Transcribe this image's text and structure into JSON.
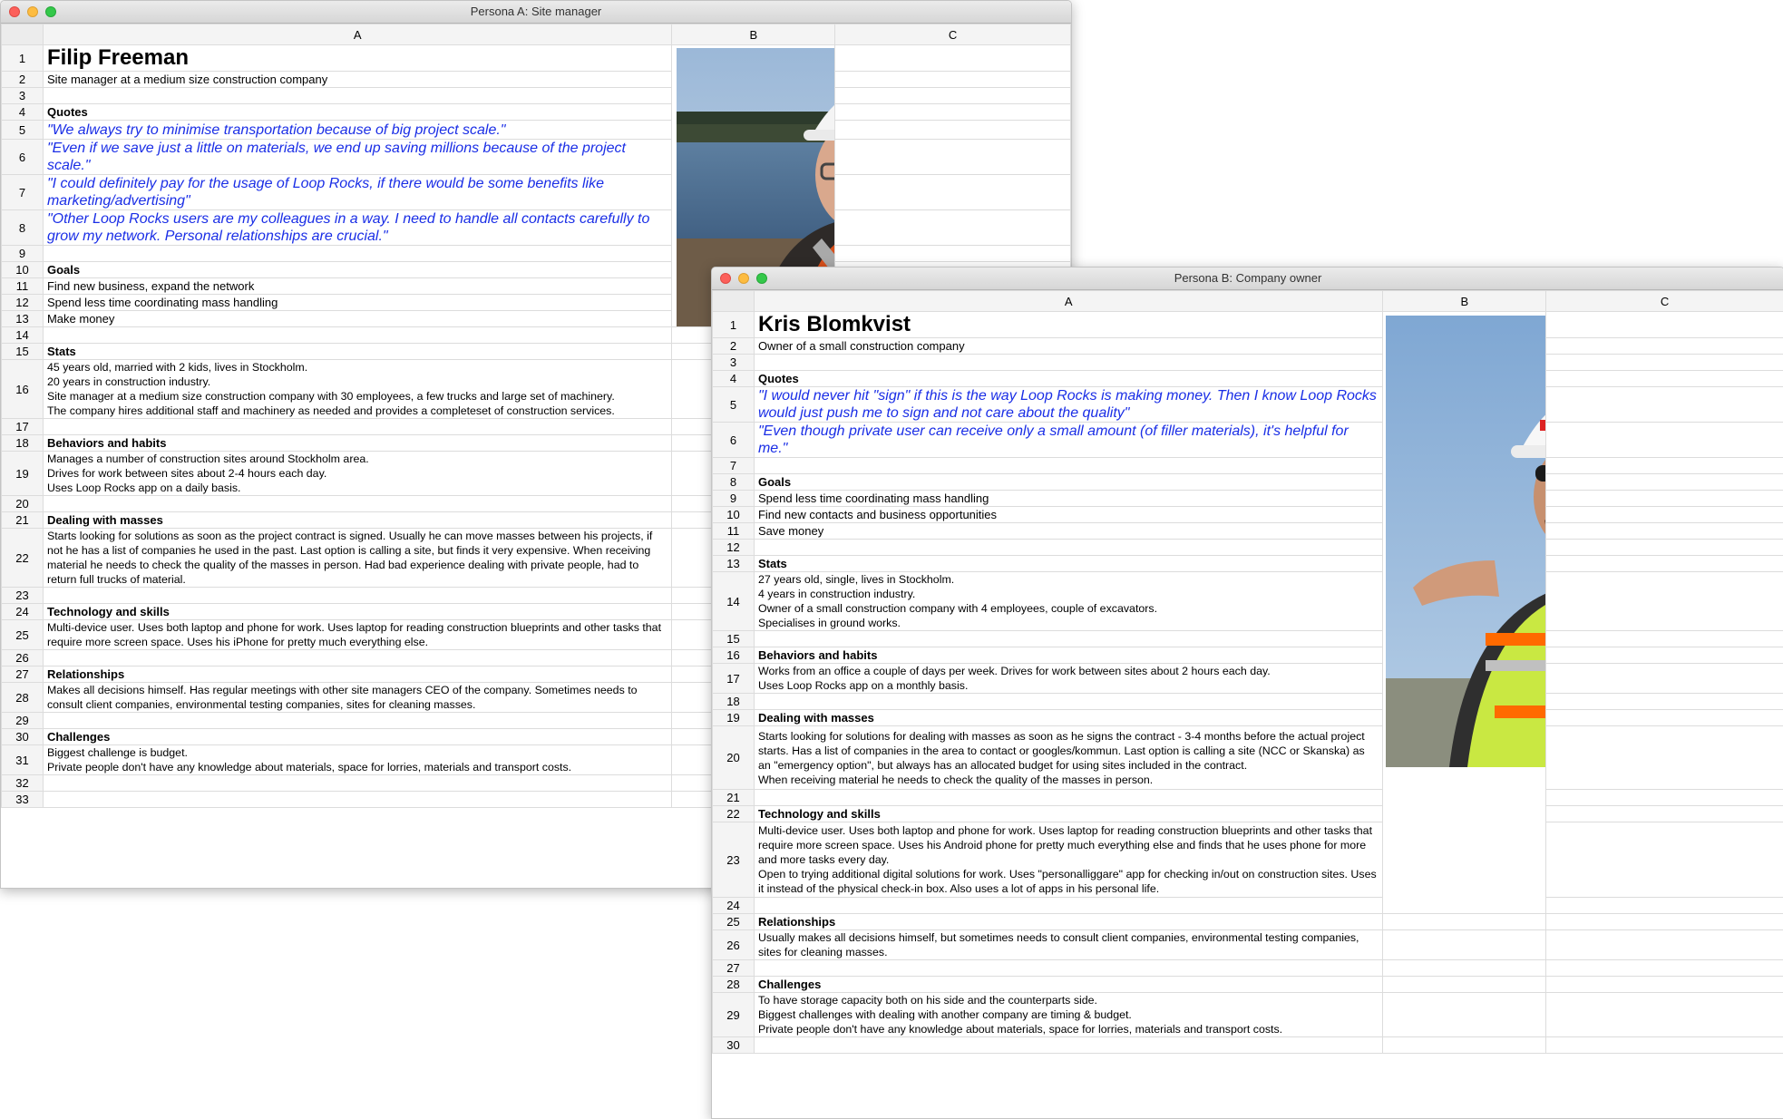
{
  "personaA": {
    "window_title": "Persona A: Site manager",
    "columns": [
      "A",
      "B",
      "C"
    ],
    "rows": [
      {
        "n": "1",
        "text": "Filip Freeman",
        "style": "name"
      },
      {
        "n": "2",
        "text": "Site manager at a medium size construction company",
        "style": "text"
      },
      {
        "n": "3",
        "text": "",
        "style": "text"
      },
      {
        "n": "4",
        "text": "Quotes",
        "style": "heading"
      },
      {
        "n": "5",
        "text": "\"We always try to minimise transportation because of big project scale.\"",
        "style": "quote"
      },
      {
        "n": "6",
        "text": "\"Even if we save just a little on materials, we end up saving millions because of the project scale.\"",
        "style": "quote"
      },
      {
        "n": "7",
        "text": "\"I could definitely pay for the usage of Loop Rocks, if there would be some benefits like marketing/advertising\"",
        "style": "quote"
      },
      {
        "n": "8",
        "text": "\"Other Loop Rocks users are my colleagues in a way. I need to handle all contacts carefully to grow my network. Personal relationships are crucial.\"",
        "style": "quote"
      },
      {
        "n": "9",
        "text": "",
        "style": "text"
      },
      {
        "n": "10",
        "text": "Goals",
        "style": "heading"
      },
      {
        "n": "11",
        "text": "Find new business, expand the network",
        "style": "text"
      },
      {
        "n": "12",
        "text": "Spend less time coordinating mass handling",
        "style": "text"
      },
      {
        "n": "13",
        "text": "Make money",
        "style": "text"
      },
      {
        "n": "14",
        "text": "",
        "style": "text"
      },
      {
        "n": "15",
        "text": "Stats",
        "style": "heading"
      },
      {
        "n": "16",
        "text": "45 years old, married with 2 kids, lives in Stockholm.\n20 years in construction industry.\nSite manager at a medium size construction company with 30 employees, a few trucks and large set of machinery.\nThe company hires additional staff and machinery as needed and provides a completeset of construction services.",
        "style": "small"
      },
      {
        "n": "17",
        "text": "",
        "style": "text"
      },
      {
        "n": "18",
        "text": "Behaviors and habits",
        "style": "heading"
      },
      {
        "n": "19",
        "text": "Manages a number of construction sites around Stockholm area.\nDrives for work between sites about 2-4 hours each day.\nUses Loop Rocks app on a daily basis.",
        "style": "small"
      },
      {
        "n": "20",
        "text": "",
        "style": "text"
      },
      {
        "n": "21",
        "text": "Dealing with masses",
        "style": "heading"
      },
      {
        "n": "22",
        "text": "Starts looking for solutions as soon as the project contract is signed. Usually he can move masses between his projects, if not he has a list of companies he used in the past. Last option is calling a site, but finds it very expensive. When receiving material he needs to check the quality of the masses in person. Had bad experience dealing with private people, had to return full trucks of material.",
        "style": "small"
      },
      {
        "n": "23",
        "text": "",
        "style": "text"
      },
      {
        "n": "24",
        "text": "Technology and skills",
        "style": "heading"
      },
      {
        "n": "25",
        "text": "Multi-device user. Uses both laptop and phone for work. Uses laptop for reading construction blueprints and other tasks that require more screen space. Uses his iPhone for pretty much everything else.",
        "style": "small"
      },
      {
        "n": "26",
        "text": "",
        "style": "text"
      },
      {
        "n": "27",
        "text": "Relationships",
        "style": "heading"
      },
      {
        "n": "28",
        "text": "Makes all decisions himself. Has regular meetings with other site managers CEO of the company. Sometimes needs to consult client companies, environmental testing companies, sites for cleaning masses.",
        "style": "small"
      },
      {
        "n": "29",
        "text": "",
        "style": "text"
      },
      {
        "n": "30",
        "text": "Challenges",
        "style": "heading"
      },
      {
        "n": "31",
        "text": "Biggest challenge is budget.\nPrivate people don't have any knowledge about materials, space for lorries, materials and transport costs.",
        "style": "small"
      },
      {
        "n": "32",
        "text": "",
        "style": "text"
      },
      {
        "n": "33",
        "text": "",
        "style": "text"
      }
    ]
  },
  "personaB": {
    "window_title": "Persona B: Company owner",
    "columns": [
      "A",
      "B",
      "C"
    ],
    "rows": [
      {
        "n": "1",
        "text": "Kris Blomkvist",
        "style": "name"
      },
      {
        "n": "2",
        "text": "Owner of a small construction company",
        "style": "text"
      },
      {
        "n": "3",
        "text": "",
        "style": "text"
      },
      {
        "n": "4",
        "text": "Quotes",
        "style": "heading"
      },
      {
        "n": "5",
        "text": "\"I would never hit \"sign\" if this is the way Loop Rocks is making money. Then I know Loop Rocks would just push me to sign and not care about the quality\"",
        "style": "quote"
      },
      {
        "n": "6",
        "text": "\"Even though private user can receive only a small amount (of filler materials), it's helpful for me.\"",
        "style": "quote"
      },
      {
        "n": "7",
        "text": "",
        "style": "text"
      },
      {
        "n": "8",
        "text": "Goals",
        "style": "heading"
      },
      {
        "n": "9",
        "text": "Spend less time coordinating mass handling",
        "style": "text"
      },
      {
        "n": "10",
        "text": "Find new contacts and business opportunities",
        "style": "text"
      },
      {
        "n": "11",
        "text": "Save money",
        "style": "text"
      },
      {
        "n": "12",
        "text": "",
        "style": "text"
      },
      {
        "n": "13",
        "text": "Stats",
        "style": "heading"
      },
      {
        "n": "14",
        "text": "27 years old, single, lives in Stockholm.\n4 years in construction industry.\nOwner of a small construction company with 4 employees, couple of excavators.\nSpecialises in ground works.",
        "style": "small"
      },
      {
        "n": "15",
        "text": "",
        "style": "text"
      },
      {
        "n": "16",
        "text": "Behaviors and habits",
        "style": "heading"
      },
      {
        "n": "17",
        "text": "Works from an office a couple of days per week. Drives for work between sites about 2 hours each day.\nUses Loop Rocks app on a monthly basis.",
        "style": "small"
      },
      {
        "n": "18",
        "text": "",
        "style": "text"
      },
      {
        "n": "19",
        "text": "Dealing with masses",
        "style": "heading"
      },
      {
        "n": "20",
        "text": "Starts looking for solutions for dealing with masses as soon as he signs the contract - 3-4 months before the actual project starts. Has a list of companies in the area to contact or googles/kommun. Last option is calling a site (NCC or Skanska) as an \"emergency option\", but always has an allocated budget for using sites included in the contract.\nWhen receiving material he needs to check the quality of the masses in person.",
        "style": "small"
      },
      {
        "n": "21",
        "text": "",
        "style": "text"
      },
      {
        "n": "22",
        "text": "Technology and skills",
        "style": "heading"
      },
      {
        "n": "23",
        "text": "Multi-device user. Uses both laptop and phone for work. Uses laptop for reading construction blueprints and other tasks that require more screen space. Uses his Android phone for pretty much everything else and finds that he uses phone for more and more tasks every day.\nOpen to trying additional digital solutions for work. Uses \"personalliggare\" app for checking in/out on construction sites. Uses it instead of the physical check-in box. Also uses a lot of apps in his personal life.",
        "style": "small"
      },
      {
        "n": "24",
        "text": "",
        "style": "text"
      },
      {
        "n": "25",
        "text": "Relationships",
        "style": "heading"
      },
      {
        "n": "26",
        "text": "Usually makes all decisions himself, but sometimes needs to consult client companies, environmental testing companies, sites for cleaning masses.",
        "style": "small"
      },
      {
        "n": "27",
        "text": "",
        "style": "text"
      },
      {
        "n": "28",
        "text": "Challenges",
        "style": "heading"
      },
      {
        "n": "29",
        "text": "To have storage capacity both on his side and the counterparts side.\nBiggest challenges with dealing with another company are timing & budget.\nPrivate people don't have any knowledge about materials, space for lorries, materials and transport costs.",
        "style": "small"
      },
      {
        "n": "30",
        "text": "",
        "style": "text"
      }
    ]
  }
}
